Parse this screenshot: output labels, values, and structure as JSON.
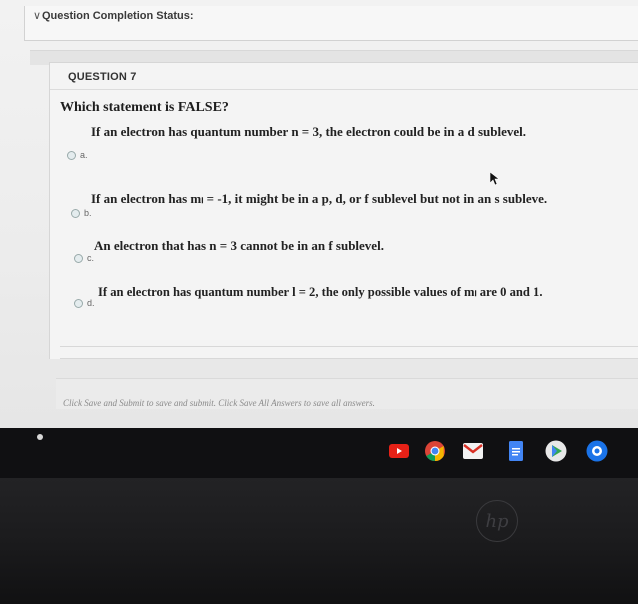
{
  "status": {
    "toggle_icon": "collapse-chevron-icon",
    "label": "Question Completion Status:"
  },
  "question": {
    "header": "QUESTION 7",
    "prompt": "Which statement is FALSE?",
    "options": [
      {
        "letter": "a.",
        "text": "If an electron has quantum number n = 3, the electron could be in a d sublevel."
      },
      {
        "letter": "b.",
        "text": "If an electron has mₗ = -1, it might be in a p, d, or f sublevel but not in an s subleve."
      },
      {
        "letter": "c.",
        "text": "An electron that has n = 3 cannot be in an f sublevel."
      },
      {
        "letter": "d.",
        "text": "If an electron has quantum number l = 2, the only possible values of mₗ are 0 and 1."
      }
    ]
  },
  "footer": {
    "instructions": "Click Save and Submit to save and submit. Click Save All Answers to save all answers."
  },
  "taskbar": {
    "apps": [
      {
        "name": "youtube-icon",
        "color": "#e62117"
      },
      {
        "name": "chrome-icon",
        "color": "#4285f4"
      },
      {
        "name": "gmail-icon",
        "color": "#d93025"
      },
      {
        "name": "docs-icon",
        "color": "#4285f4"
      },
      {
        "name": "play-store-icon",
        "color": "#34a853"
      },
      {
        "name": "chrome-remote-icon",
        "color": "#1a73e8"
      }
    ]
  },
  "brand": {
    "logo": "hp"
  }
}
